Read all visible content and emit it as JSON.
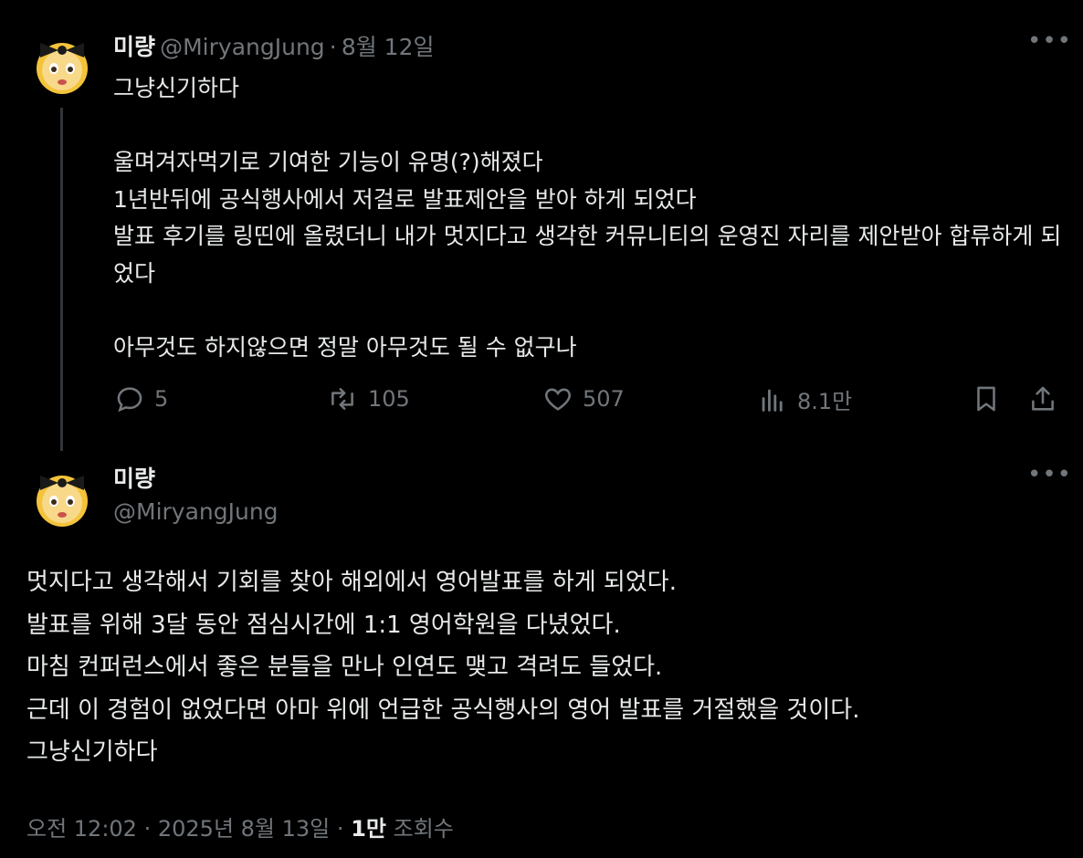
{
  "tweet1": {
    "name": "미량",
    "handle": "@MiryangJung",
    "separator": "·",
    "date": "8월 12일",
    "text": "그냥신기하다\n\n울며겨자먹기로 기여한 기능이 유명(?)해졌다\n1년반뒤에 공식행사에서 저걸로 발표제안을 받아 하게 되었다\n발표 후기를 링띤에 올렸더니 내가 멋지다고 생각한 커뮤니티의 운영진 자리를 제안받아 합류하게 되었다\n\n아무것도 하지않으면 정말 아무것도 될 수 없구나",
    "stats": {
      "replies": "5",
      "reposts": "105",
      "likes": "507",
      "views": "8.1만"
    }
  },
  "tweet2": {
    "name": "미량",
    "handle": "@MiryangJung",
    "text": "멋지다고 생각해서 기회를 찾아 해외에서 영어발표를 하게 되었다.\n발표를 위해 3달 동안 점심시간에 1:1 영어학원을 다녔었다.\n마침 컨퍼런스에서 좋은 분들을 만나 인연도 맺고 격려도 들었다.\n근데 이 경험이 없었다면 아마 위에 언급한 공식행사의 영어 발표를 거절했을 것이다.\n그냥신기하다",
    "time": "오전 12:02",
    "date": "2025년 8월 13일",
    "views_count": "1만",
    "views_label": "조회수"
  },
  "icons": {
    "more": "more-horizontal-icon",
    "reply": "reply-bubble-icon",
    "repost": "repost-icon",
    "like": "heart-icon",
    "views": "views-bar-chart-icon",
    "bookmark": "bookmark-icon",
    "share": "share-icon",
    "avatar": "bow-emoji-avatar"
  },
  "colors": {
    "background": "#000000",
    "text": "#e7e9ea",
    "secondary": "#71767b",
    "thread_line": "#333639"
  }
}
